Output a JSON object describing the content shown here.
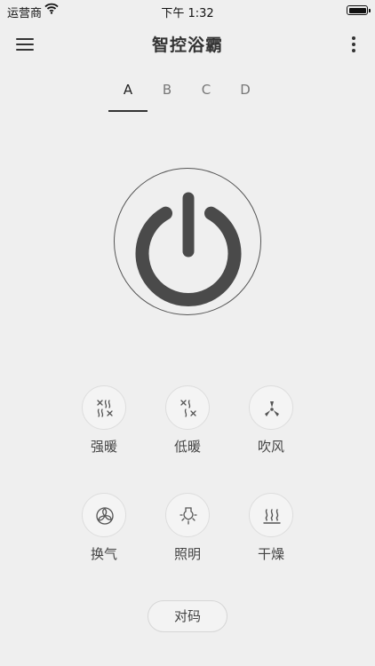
{
  "status_bar": {
    "carrier": "运营商",
    "time": "下午 1:32"
  },
  "header": {
    "title": "智控浴霸"
  },
  "tabs": [
    {
      "label": "A",
      "active": true
    },
    {
      "label": "B",
      "active": false
    },
    {
      "label": "C",
      "active": false
    },
    {
      "label": "D",
      "active": false
    }
  ],
  "functions": [
    {
      "label": "强暖",
      "icon": "strong-heat-icon"
    },
    {
      "label": "低暖",
      "icon": "low-heat-icon"
    },
    {
      "label": "吹风",
      "icon": "fan-icon"
    },
    {
      "label": "换气",
      "icon": "ventilation-icon"
    },
    {
      "label": "照明",
      "icon": "lightbulb-icon"
    },
    {
      "label": "干燥",
      "icon": "drying-icon"
    }
  ],
  "pair_button": {
    "label": "对码"
  },
  "colors": {
    "background": "#efefef",
    "accent": "#4a4a4a",
    "text": "#333333"
  }
}
